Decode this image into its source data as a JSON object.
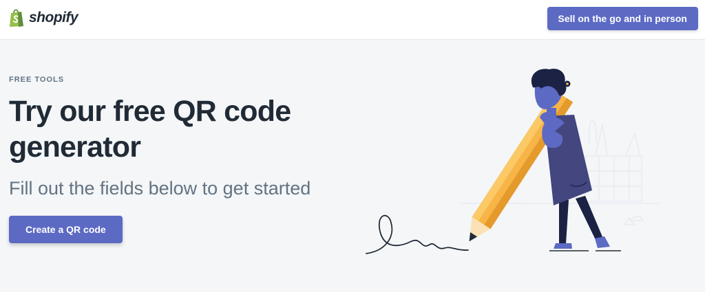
{
  "header": {
    "brand": "shopify",
    "cta_label": "Sell on the go and in person"
  },
  "hero": {
    "eyebrow": "FREE TOOLS",
    "headline": "Try our free QR code generator",
    "subheadline": "Fill out the fields below to get started",
    "cta_label": "Create a QR code"
  },
  "colors": {
    "brand_green": "#95bf47",
    "accent": "#5c6ac4",
    "text_dark": "#212b36",
    "text_muted": "#637381",
    "background": "#f4f6f8"
  },
  "icons": {
    "logo": "shopify-bag-icon",
    "illustration": "person-with-pencil-illustration"
  }
}
